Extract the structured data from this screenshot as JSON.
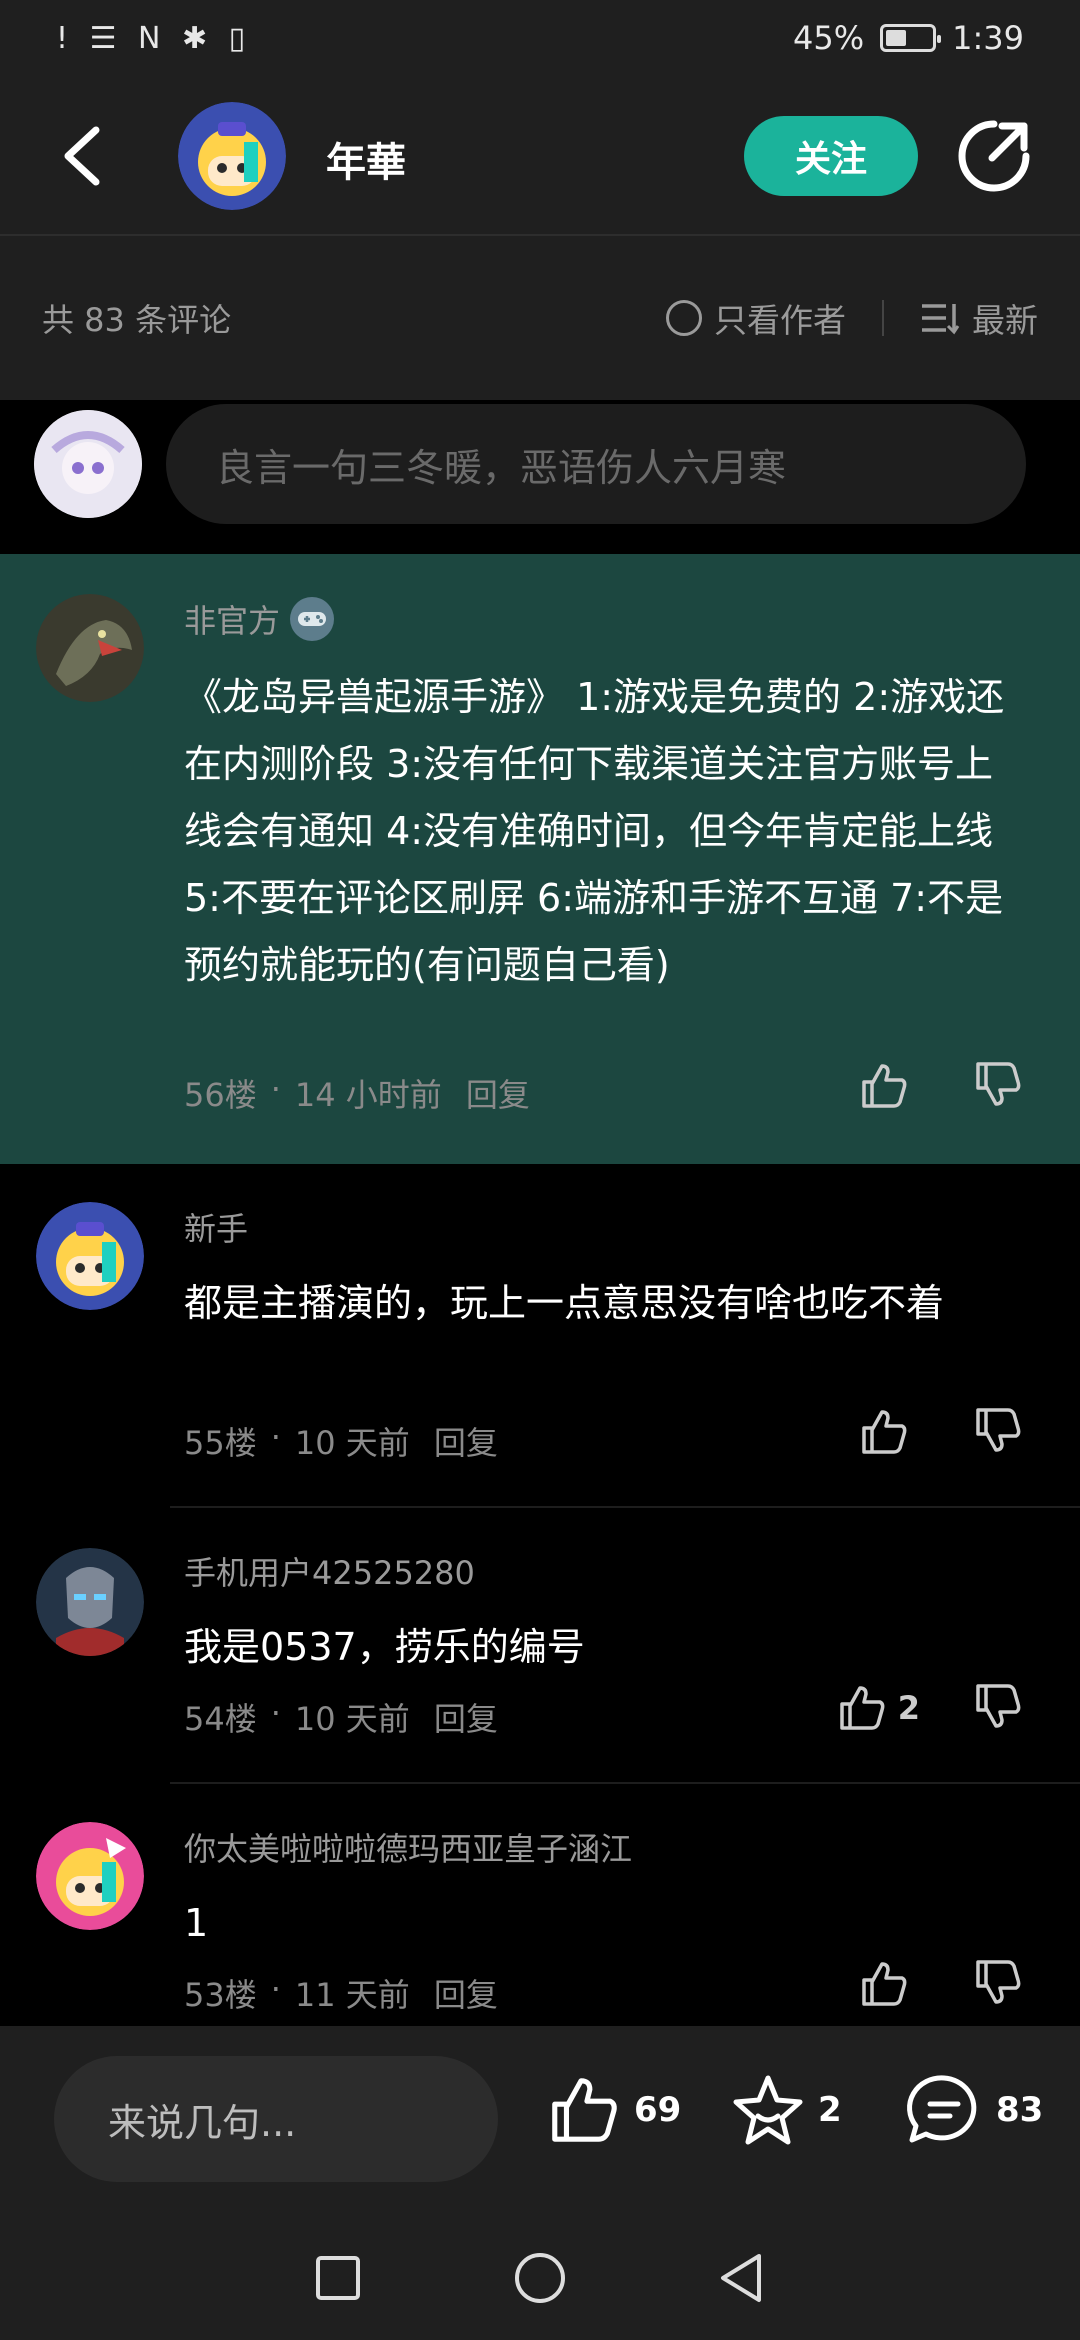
{
  "status_bar": {
    "left_icons": "! ☰ N ✱ ▯",
    "battery": "45%",
    "battery_level": 0.45,
    "time": "1:39"
  },
  "header": {
    "title": "年華",
    "follow_label": "关注"
  },
  "comments_bar": {
    "count_text": "共 83 条评论",
    "author_only": "只看作者",
    "sort": "最新"
  },
  "input": {
    "placeholder": "良言一句三冬暖，恶语伤人六月寒"
  },
  "comments": [
    {
      "user": "非官方",
      "text": "《龙岛异兽起源手游》 1:游戏是免费的 2:游戏还在内测阶段 3:没有任何下载渠道关注官方账号上线会有通知 4:没有准确时间，但今年肯定能上线 5:不要在评论区刷屏 6:端游和手游不互通 7:不是预约就能玩的(有问题自己看)",
      "floor": "56楼",
      "time": "14 小时前",
      "reply": "回复",
      "likes": ""
    },
    {
      "user": "新手",
      "text": "都是主播演的，玩上一点意思没有啥也吃不着",
      "floor": "55楼",
      "time": "10 天前",
      "reply": "回复",
      "likes": ""
    },
    {
      "user": "手机用户42525280",
      "text": "我是0537，捞乐的编号",
      "floor": "54楼",
      "time": "10 天前",
      "reply": "回复",
      "likes": "2"
    },
    {
      "user": "你太美啦啦啦德玛西亚皇子涵江",
      "text": "1",
      "floor": "53楼",
      "time": "11 天前",
      "reply": "回复",
      "likes": ""
    }
  ],
  "bottom_bar": {
    "say_placeholder": "来说几句...",
    "likes": "69",
    "favorites": "2",
    "comments": "83"
  },
  "colors": {
    "accent": "#1bb39b",
    "highlight_bg": "#1c4740",
    "bg": "#000000",
    "panel": "#1f1f1f"
  }
}
